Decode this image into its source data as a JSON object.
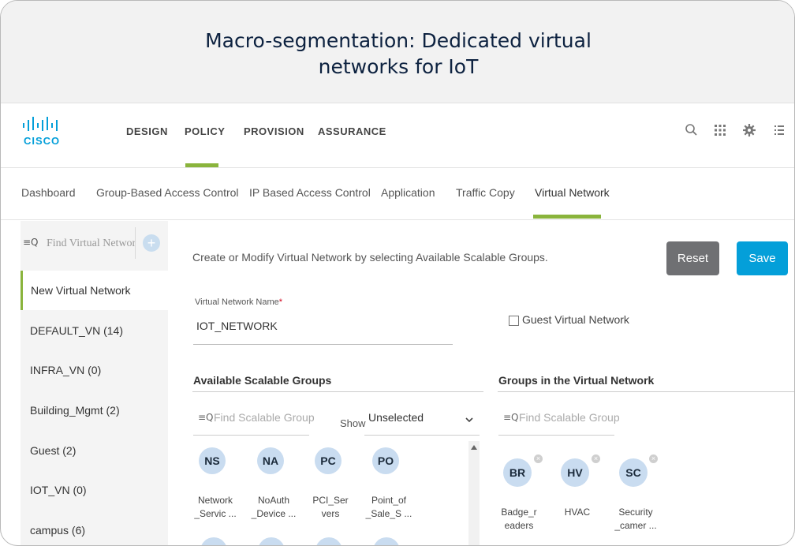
{
  "banner": {
    "title": "Macro-segmentation: Dedicated virtual\nnetworks for IoT"
  },
  "brand": {
    "logo_text": "CISCO",
    "accent": "#8ab43c",
    "cisco_blue": "#049fd9"
  },
  "topnav": {
    "items": [
      "DESIGN",
      "POLICY",
      "PROVISION",
      "ASSURANCE"
    ],
    "active": "POLICY",
    "icons": [
      "search-icon",
      "apps-grid-icon",
      "gear-icon",
      "menu-list-icon"
    ]
  },
  "subnav": {
    "items": [
      "Dashboard",
      "Group-Based Access Control",
      "IP Based Access Control",
      "Application",
      "Traffic Copy",
      "Virtual Network"
    ],
    "active": "Virtual Network"
  },
  "sidebar": {
    "search_icon": "≡Q",
    "search_placeholder": "Find Virtual Networ",
    "add_label": "+",
    "items": [
      {
        "label": "New Virtual Network"
      },
      {
        "label": "DEFAULT_VN  (14)"
      },
      {
        "label": "INFRA_VN  (0)"
      },
      {
        "label": "Building_Mgmt  (2)"
      },
      {
        "label": "Guest  (2)"
      },
      {
        "label": "IOT_VN  (0)"
      },
      {
        "label": "campus  (6)"
      }
    ],
    "selected": "New Virtual Network"
  },
  "main": {
    "description": "Create or Modify Virtual Network by selecting Available Scalable Groups.",
    "reset_label": "Reset",
    "save_label": "Save",
    "vn_name_label": "Virtual Network Name",
    "required_mark": "*",
    "vn_name_value": "IOT_NETWORK",
    "guest_vn_label": "Guest Virtual Network",
    "guest_vn_checked": false
  },
  "available_groups": {
    "title": "Available Scalable Groups",
    "search_icon": "≡Q",
    "search_placeholder": "Find Scalable Group",
    "show_label": "Show",
    "filter_value": "Unselected",
    "items": [
      {
        "abbr": "NS",
        "label_line1": "Network",
        "label_line2": "_Servic ..."
      },
      {
        "abbr": "NA",
        "label_line1": "NoAuth",
        "label_line2": "_Device ..."
      },
      {
        "abbr": "PC",
        "label_line1": "PCI_Ser",
        "label_line2": "vers"
      },
      {
        "abbr": "PO",
        "label_line1": "Point_of",
        "label_line2": "_Sale_S ..."
      }
    ]
  },
  "vn_groups": {
    "title": "Groups in the Virtual Network",
    "search_icon": "≡Q",
    "search_placeholder": "Find Scalable Group",
    "remove_icon": "×",
    "items": [
      {
        "abbr": "BR",
        "label_line1": "Badge_r",
        "label_line2": "eaders"
      },
      {
        "abbr": "HV",
        "label_line1": "HVAC",
        "label_line2": ""
      },
      {
        "abbr": "SC",
        "label_line1": "Security",
        "label_line2": "_camer ..."
      }
    ]
  }
}
